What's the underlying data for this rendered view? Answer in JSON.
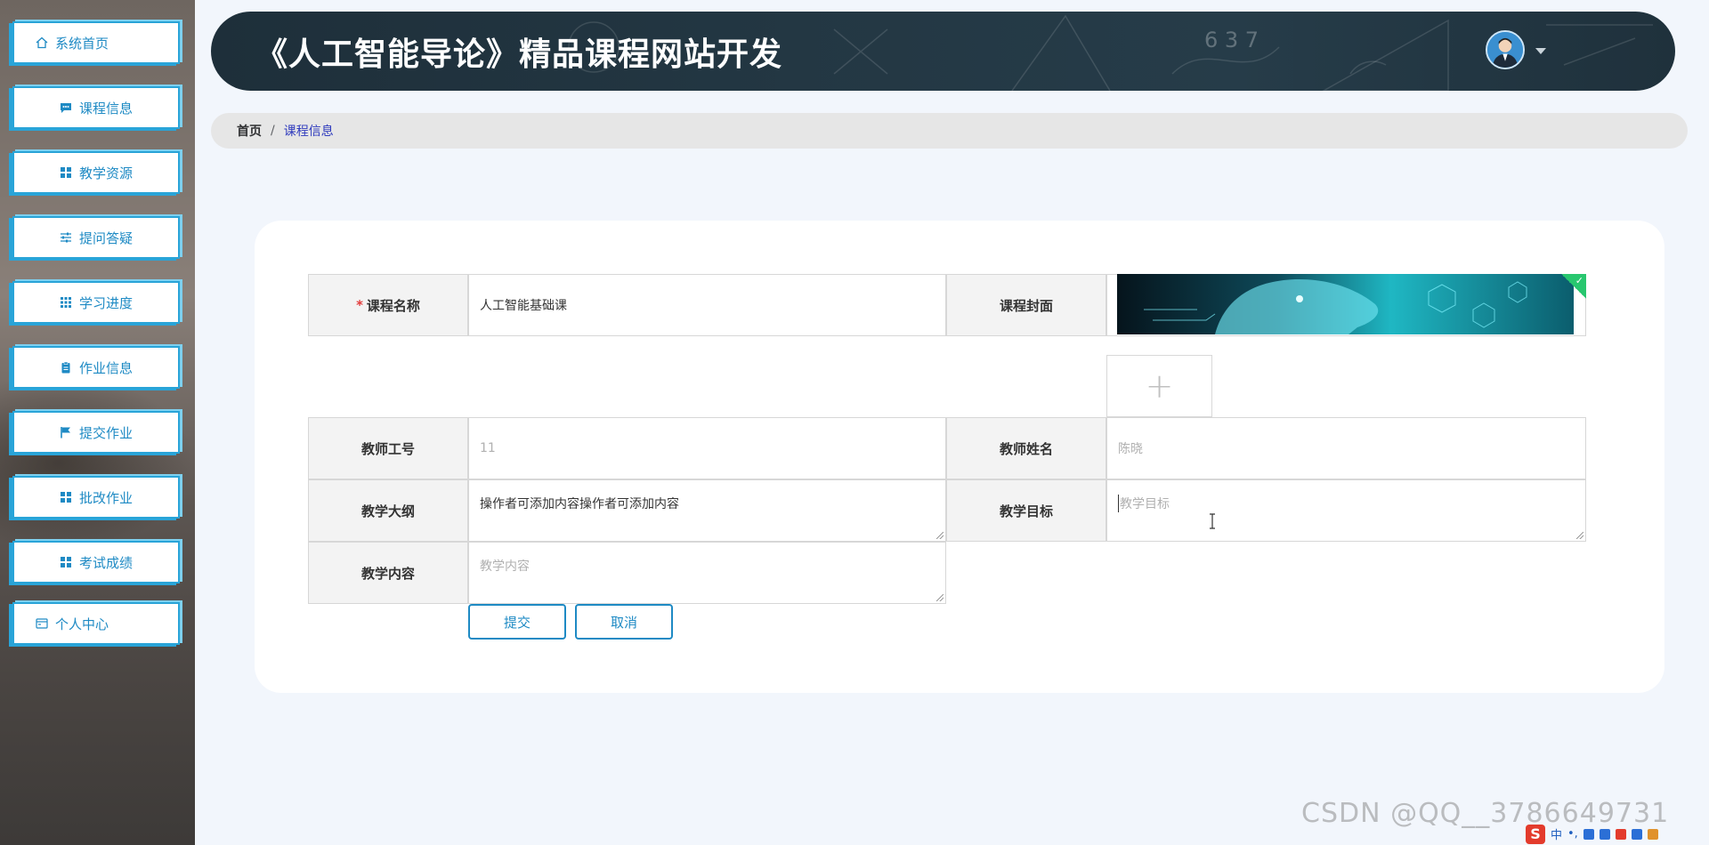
{
  "sidebar": {
    "items": [
      {
        "label": "系统首页",
        "icon": "home-icon"
      },
      {
        "label": "课程信息",
        "icon": "chat-icon"
      },
      {
        "label": "教学资源",
        "icon": "grid-icon"
      },
      {
        "label": "提问答疑",
        "icon": "sliders-icon"
      },
      {
        "label": "学习进度",
        "icon": "apps-icon"
      },
      {
        "label": "作业信息",
        "icon": "clipboard-icon"
      },
      {
        "label": "提交作业",
        "icon": "flag-icon"
      },
      {
        "label": "批改作业",
        "icon": "grid-icon"
      },
      {
        "label": "考试成绩",
        "icon": "grid-icon"
      },
      {
        "label": "个人中心",
        "icon": "card-icon"
      }
    ]
  },
  "header": {
    "title": "《人工智能导论》精品课程网站开发",
    "board_numbers": "6 3 7",
    "avatar_icon": "avatar-icon",
    "caret_icon": "caret-down-icon"
  },
  "breadcrumb": {
    "home": "首页",
    "separator": "/",
    "current": "课程信息"
  },
  "form": {
    "course_name": {
      "label": "课程名称",
      "required_mark": "*",
      "value": "人工智能基础课"
    },
    "cover": {
      "label": "课程封面",
      "upload_icon": "plus-icon",
      "upload_glyph": "+",
      "check_glyph": "✓"
    },
    "teacher_id": {
      "label": "教师工号",
      "value": "11"
    },
    "teacher_name": {
      "label": "教师姓名",
      "value": "陈晓"
    },
    "syllabus": {
      "label": "教学大纲",
      "value": "操作者可添加内容操作者可添加内容"
    },
    "goal": {
      "label": "教学目标",
      "placeholder": "教学目标"
    },
    "content": {
      "label": "教学内容",
      "placeholder": "教学内容"
    },
    "submit_label": "提交",
    "cancel_label": "取消"
  },
  "watermark": "CSDN @QQ__3786649731",
  "tray": {
    "logo": "S",
    "lang": "中",
    "punct": "•,"
  },
  "colors": {
    "accent": "#1e8ac4",
    "sidebar_border": "#29a4d8",
    "header_bg": "#233743",
    "required": "#e23b3b"
  }
}
